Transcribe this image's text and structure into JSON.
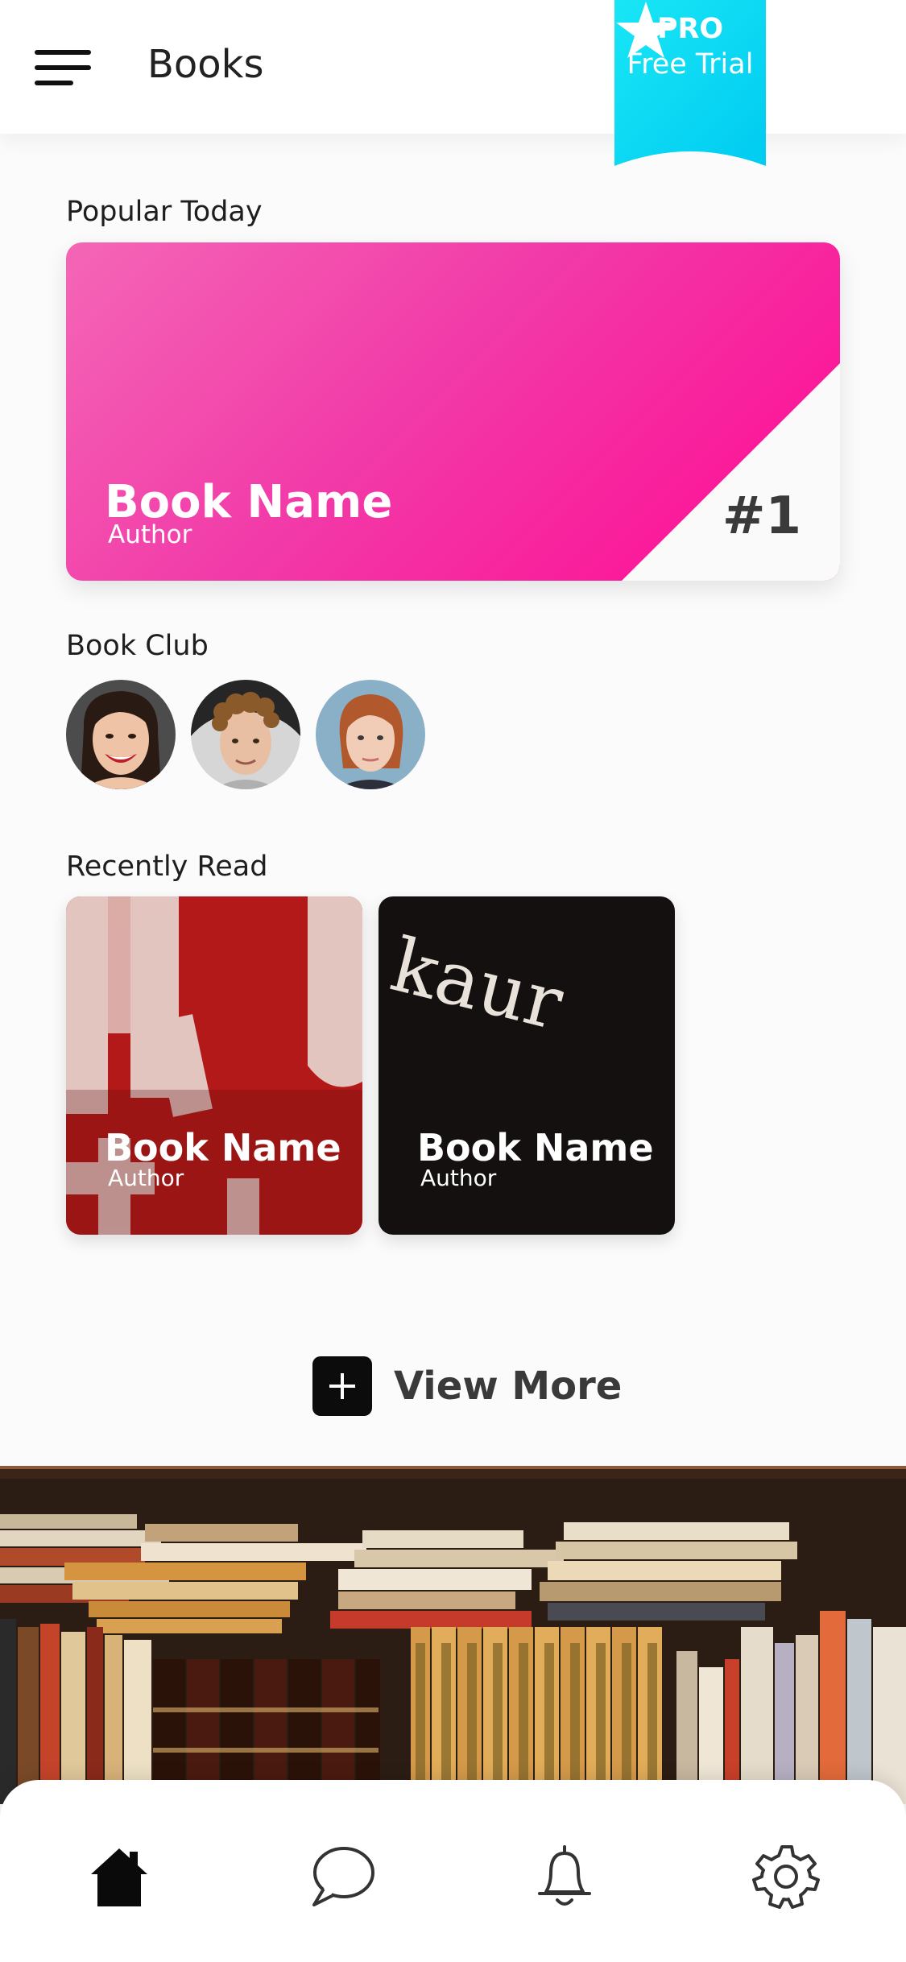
{
  "header": {
    "title": "Books",
    "menu_icon": "hamburger-menu-icon"
  },
  "pro_badge": {
    "title": "PRO",
    "subtitle": "Free Trial",
    "icon": "star-icon",
    "color": "#00d9f5"
  },
  "popular": {
    "section_label": "Popular Today",
    "book": {
      "name": "Book Name",
      "author": "Author",
      "rank": "#1"
    },
    "colors": {
      "start": "#f466b6",
      "end": "#ff0a93"
    }
  },
  "book_club": {
    "section_label": "Book Club",
    "members": [
      {
        "icon": "avatar-woman-smiling"
      },
      {
        "icon": "avatar-man-curly-hair"
      },
      {
        "icon": "avatar-woman-red-hair"
      }
    ]
  },
  "recently_read": {
    "section_label": "Recently Read",
    "books": [
      {
        "name": "Book Name",
        "author": "Author",
        "cover": "red-cover-with-letters"
      },
      {
        "name": "Book Name",
        "author": "Author",
        "cover": "black-cover-with-script",
        "cover_text": "kaur"
      }
    ]
  },
  "view_more": {
    "label": "View More",
    "icon": "plus-icon"
  },
  "nav": [
    {
      "name": "home",
      "icon": "home-icon",
      "active": true
    },
    {
      "name": "messages",
      "icon": "chat-bubble-icon"
    },
    {
      "name": "notifications",
      "icon": "bell-icon"
    },
    {
      "name": "settings",
      "icon": "gear-icon"
    }
  ]
}
